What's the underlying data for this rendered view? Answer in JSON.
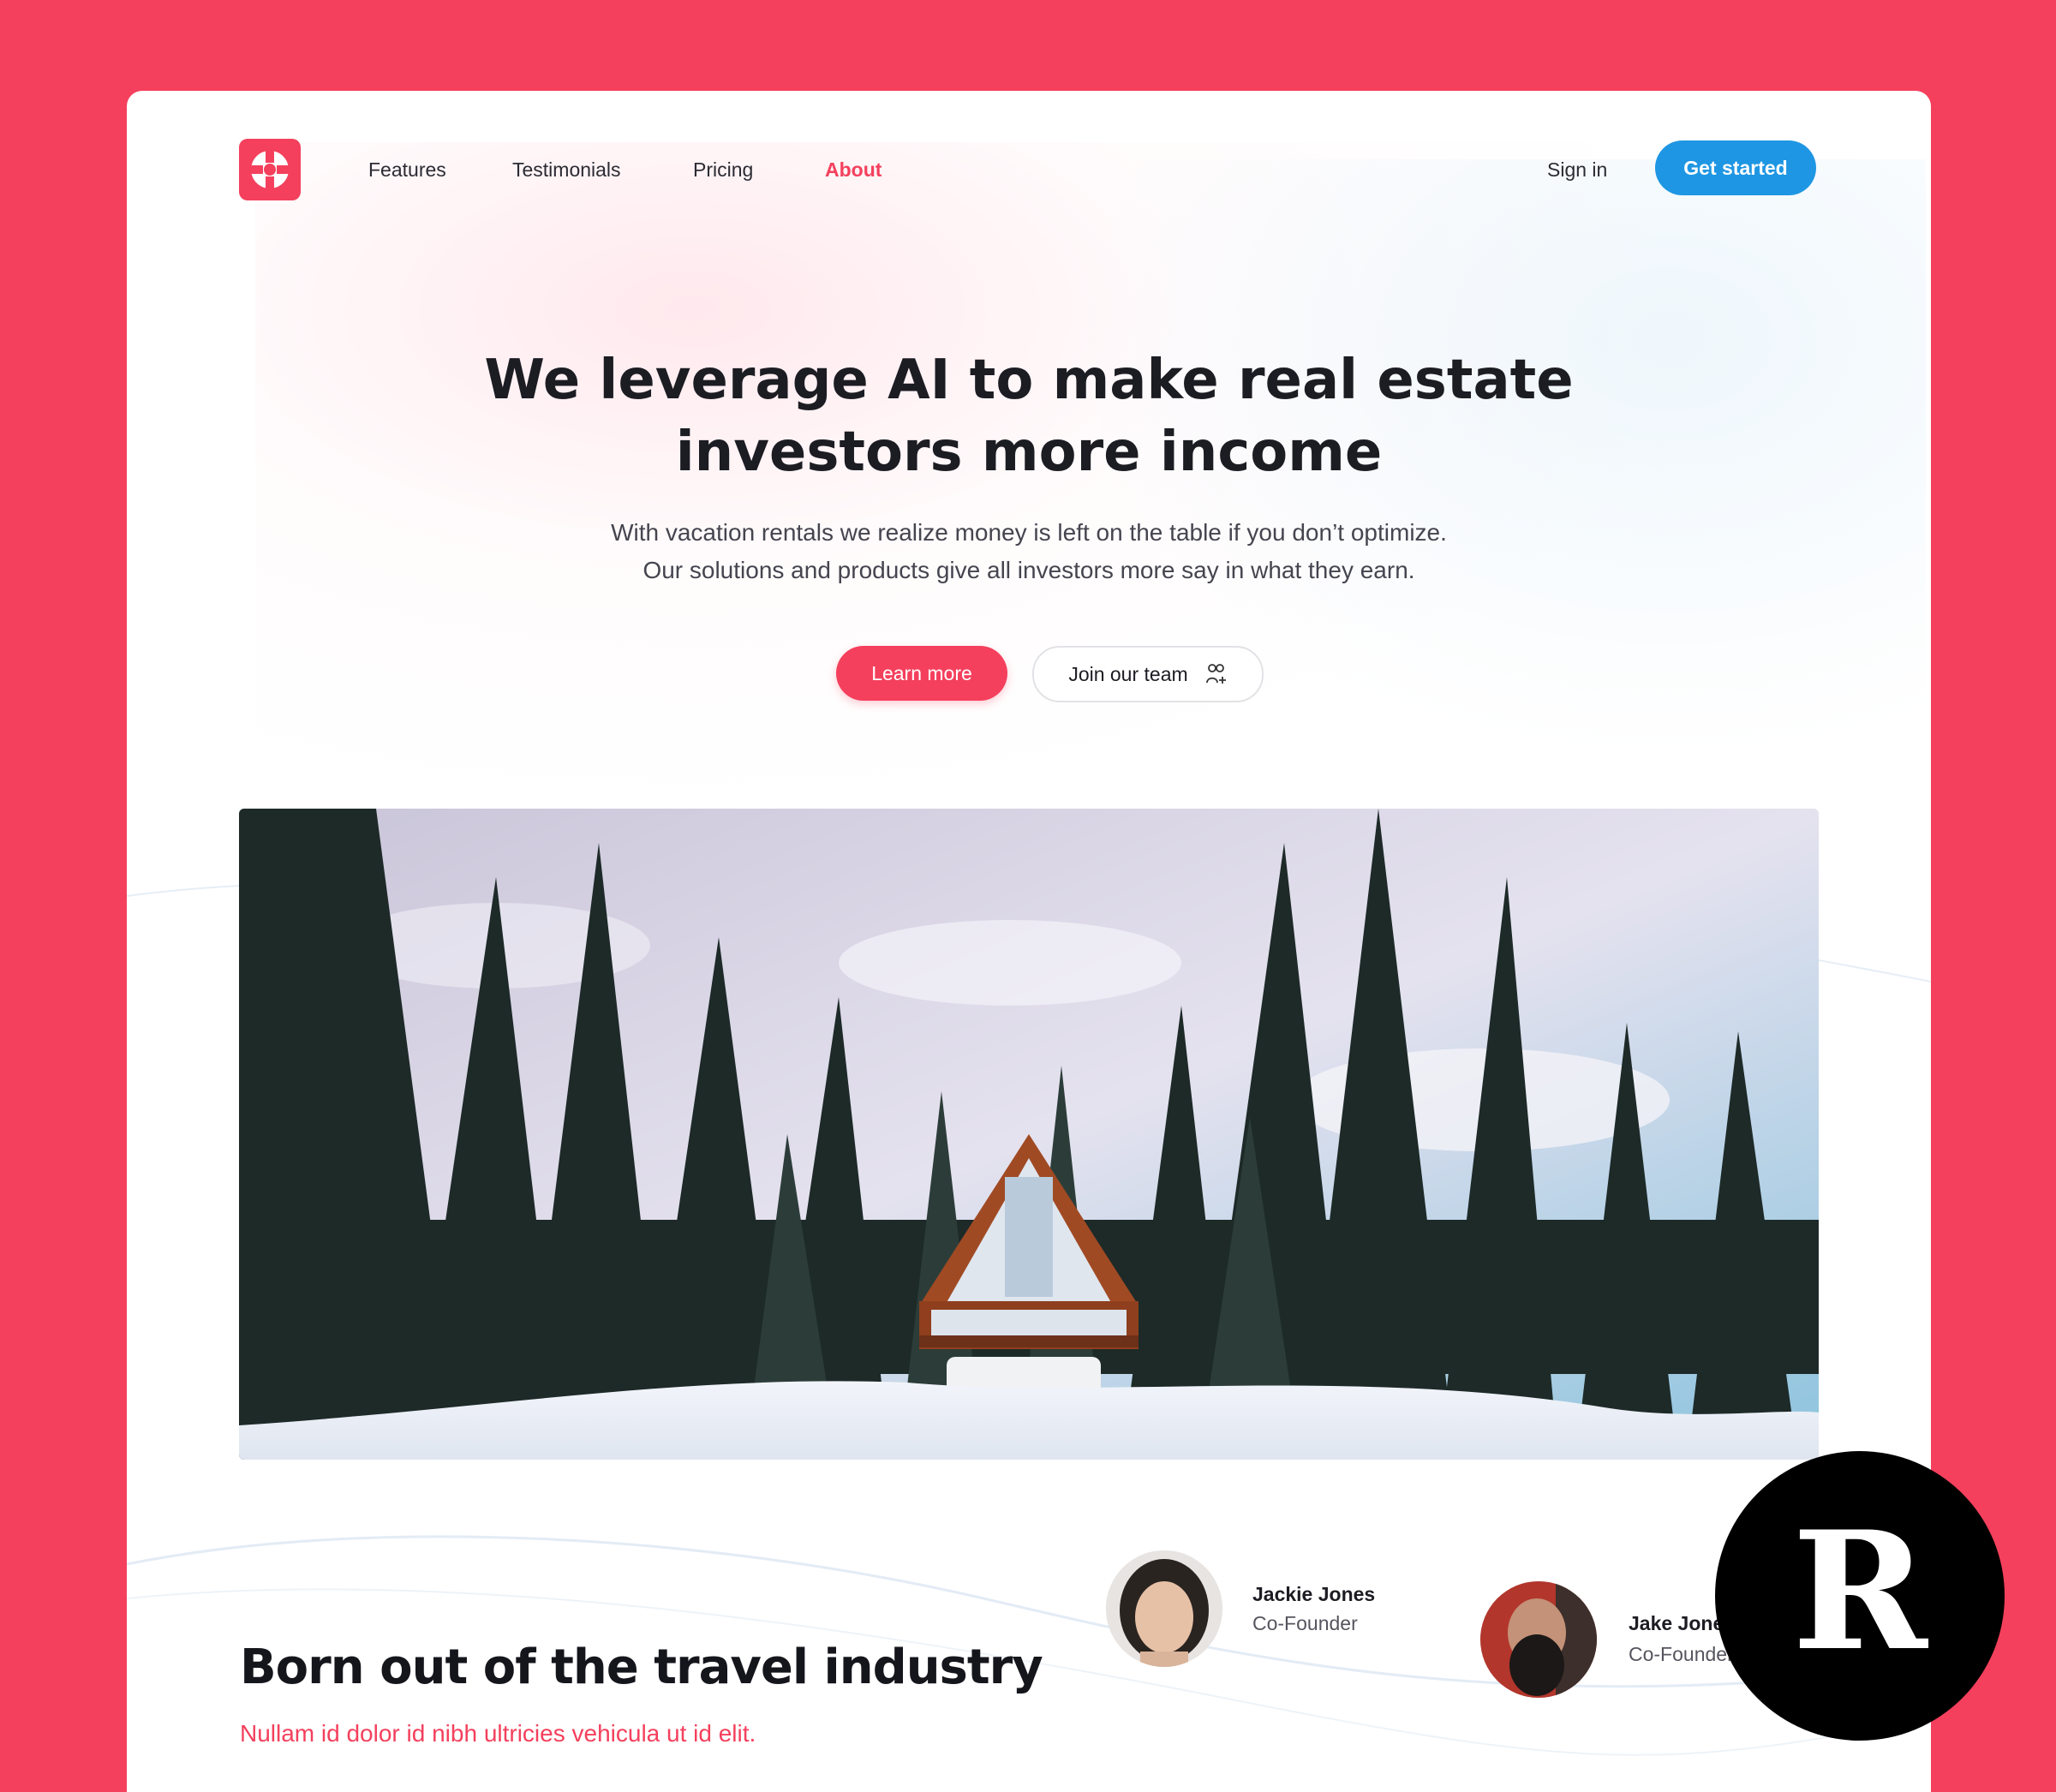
{
  "nav": {
    "links": [
      {
        "label": "Features"
      },
      {
        "label": "Testimonials"
      },
      {
        "label": "Pricing"
      },
      {
        "label": "About"
      }
    ],
    "active": "About",
    "sign_in": "Sign in",
    "get_started": "Get started"
  },
  "hero": {
    "title_line1": "We leverage AI to make real estate",
    "title_line2": "investors more income",
    "subtitle_line1": "With vacation rentals we realize money is left on the table if you don’t optimize.",
    "subtitle_line2": "Our solutions and products give all investors more say in what they earn.",
    "learn_more": "Learn more",
    "join_team": "Join our team"
  },
  "about": {
    "title": "Born out of the travel industry",
    "subtitle": "Nullam id dolor id nibh ultricies vehicula ut id elit."
  },
  "team": [
    {
      "name": "Jackie Jones",
      "role": "Co-Founder"
    },
    {
      "name": "Jake Jones",
      "role": "Co-Founder"
    }
  ],
  "badge": {
    "letter": "R"
  },
  "colors": {
    "background": "#f4405d",
    "accent": "#f4405d",
    "primary_button": "#1e96e3",
    "text": "#1c1c23"
  },
  "icons": {
    "logo": "logo-mark-icon",
    "join": "user-plus-icon"
  }
}
